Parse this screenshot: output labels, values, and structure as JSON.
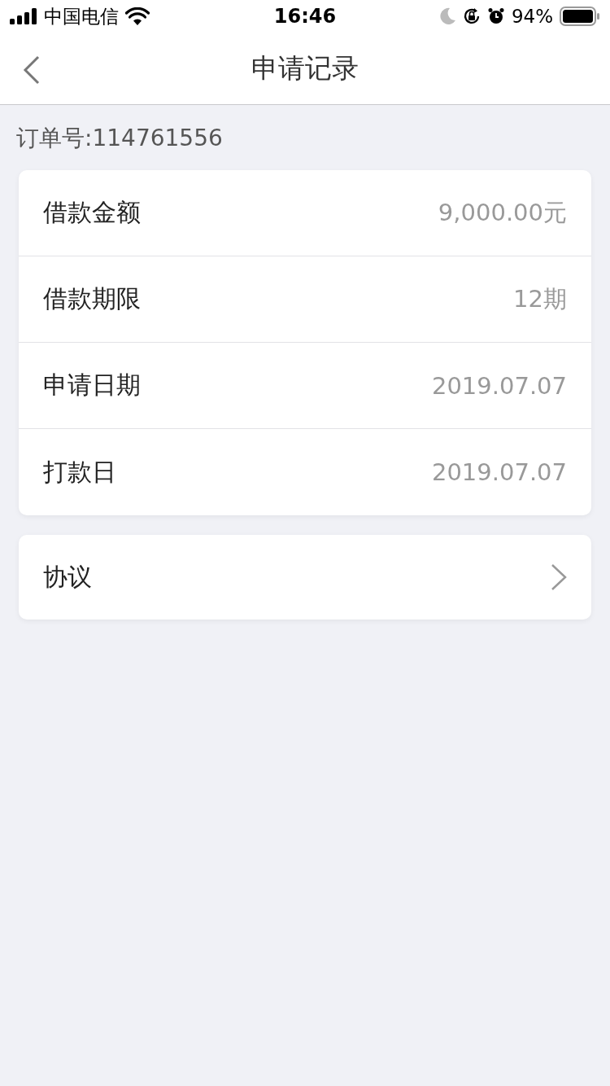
{
  "status_bar": {
    "carrier": "中国电信",
    "time": "16:46",
    "battery": "94%"
  },
  "nav": {
    "title": "申请记录"
  },
  "order_number": "订单号:114761556",
  "details": [
    {
      "label": "借款金额",
      "value": "9,000.00元"
    },
    {
      "label": "借款期限",
      "value": "12期"
    },
    {
      "label": "申请日期",
      "value": "2019.07.07"
    },
    {
      "label": "打款日",
      "value": "2019.07.07"
    }
  ],
  "agreement": {
    "label": "协议"
  }
}
